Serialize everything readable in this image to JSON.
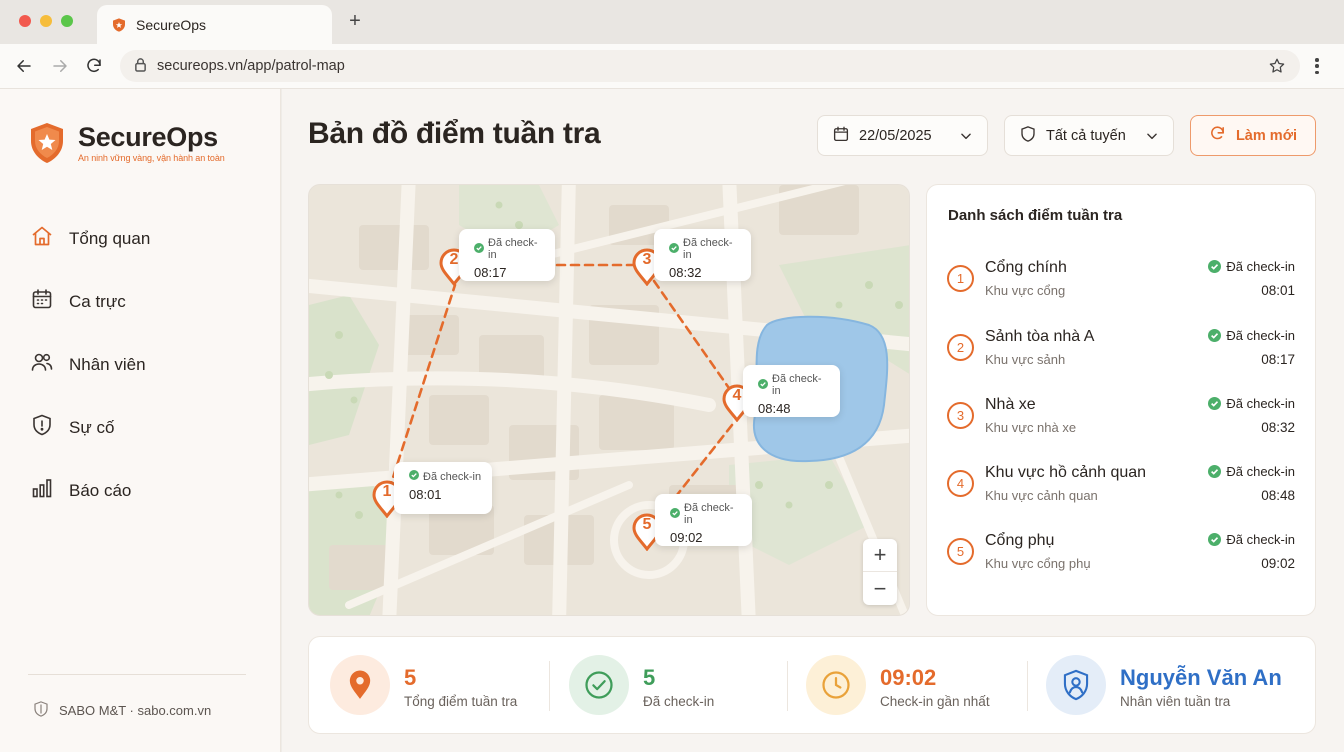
{
  "browser": {
    "tab_title": "SecureOps",
    "new_tab_glyph": "+",
    "url": "secureops.vn/app/patrol-map"
  },
  "brand": {
    "name": "SecureOps",
    "tagline": "An ninh vững vàng, vận hành an toàn",
    "accent_color": "#e46b2c"
  },
  "sidebar": {
    "items": [
      {
        "label": "Tổng quan",
        "icon": "home-icon"
      },
      {
        "label": "Ca trực",
        "icon": "calendar-icon"
      },
      {
        "label": "Nhân viên",
        "icon": "users-icon"
      },
      {
        "label": "Sự cố",
        "icon": "shield-alert-icon"
      },
      {
        "label": "Báo cáo",
        "icon": "bar-chart-icon"
      }
    ],
    "footer": "SABO M&T · sabo.com.vn"
  },
  "header": {
    "title": "Bản đồ điểm tuần tra",
    "date": "22/05/2025",
    "route_filter": "Tất cả tuyến",
    "refresh_label": "Làm mới"
  },
  "map": {
    "zoom_in": "+",
    "zoom_out": "−",
    "callouts": [
      {
        "num": "1",
        "status": "Đã check-in",
        "time": "08:01"
      },
      {
        "num": "2",
        "status": "Đã check-in",
        "time": "08:17"
      },
      {
        "num": "3",
        "status": "Đã check-in",
        "time": "08:32"
      },
      {
        "num": "4",
        "status": "Đã check-in",
        "time": "08:48"
      },
      {
        "num": "5",
        "status": "Đã check-in",
        "time": "09:02"
      }
    ]
  },
  "checkpoint_list": {
    "title": "Danh sách điểm tuần tra",
    "items": [
      {
        "num": "1",
        "name": "Cổng chính",
        "area": "Khu vực cổng",
        "status": "Đã check-in",
        "time": "08:01"
      },
      {
        "num": "2",
        "name": "Sảnh tòa nhà A",
        "area": "Khu vực sảnh",
        "status": "Đã check-in",
        "time": "08:17"
      },
      {
        "num": "3",
        "name": "Nhà xe",
        "area": "Khu vực nhà xe",
        "status": "Đã check-in",
        "time": "08:32"
      },
      {
        "num": "4",
        "name": "Khu vực hồ cảnh quan",
        "area": "Khu vực cảnh quan",
        "status": "Đã check-in",
        "time": "08:48"
      },
      {
        "num": "5",
        "name": "Cổng phụ",
        "area": "Khu vực cổng phụ",
        "status": "Đã check-in",
        "time": "09:02"
      }
    ]
  },
  "stats": {
    "total": {
      "value": "5",
      "label": "Tổng điểm tuần tra",
      "color": "#e46b2c"
    },
    "checked_in": {
      "value": "5",
      "label": "Đã check-in",
      "color": "#3f9d5a"
    },
    "last_checkin": {
      "value": "09:02",
      "label": "Check-in gần nhất",
      "color": "#e46b2c"
    },
    "guard": {
      "value": "Nguyễn Văn An",
      "label": "Nhân viên tuần tra",
      "color": "#2f6fc6"
    }
  }
}
